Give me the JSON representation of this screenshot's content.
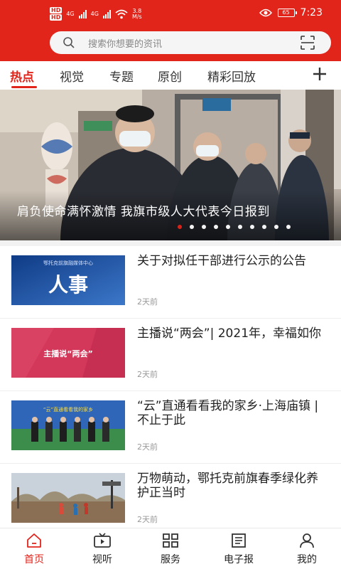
{
  "status_bar": {
    "hd1": "HD",
    "hd2": "HD",
    "net1": "4G",
    "net2": "4G",
    "speed_value": "3.8",
    "speed_unit": "M/s",
    "battery": "65",
    "time": "7:23"
  },
  "search": {
    "placeholder": "搜索你想要的资讯"
  },
  "tabs": [
    {
      "label": "热点",
      "active": true
    },
    {
      "label": "视觉"
    },
    {
      "label": "专题"
    },
    {
      "label": "原创"
    },
    {
      "label": "精彩回放"
    }
  ],
  "banner": {
    "caption": "肩负使命满怀激情  我旗市级人大代表今日报到",
    "dot_count": 10,
    "active_dot": 0
  },
  "news": [
    {
      "title": "关于对拟任干部进行公示的公告",
      "time": "2天前",
      "thumb_header": "鄂托克前旗融媒体中心",
      "thumb_text": "人事"
    },
    {
      "title": "主播说“两会”| 2021年，幸福如你",
      "time": "2天前",
      "thumb_text": "主播说“两会”"
    },
    {
      "title": "“云”直通看看我的家乡·上海庙镇 | 不止于此",
      "time": "2天前",
      "thumb_text": "“云”直通看看我的家乡"
    },
    {
      "title": "万物萌动，鄂托克前旗春季绿化养护正当时",
      "time": "2天前"
    }
  ],
  "bottom_nav": [
    {
      "label": "首页",
      "icon": "home-icon",
      "active": true
    },
    {
      "label": "视听",
      "icon": "tv-icon"
    },
    {
      "label": "服务",
      "icon": "grid-icon"
    },
    {
      "label": "电子报",
      "icon": "newspaper-icon"
    },
    {
      "label": "我的",
      "icon": "user-icon"
    }
  ],
  "colors": {
    "brand": "#e1251b",
    "text": "#222222",
    "muted": "#999999"
  }
}
